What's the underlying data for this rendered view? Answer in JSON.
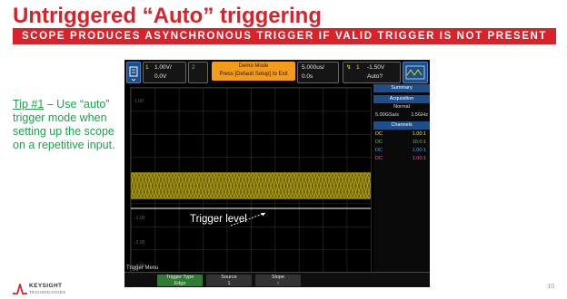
{
  "slide": {
    "title": "Untriggered “Auto” triggering",
    "banner": "SCOPE PRODUCES ASYNCHRONOUS TRIGGER IF VALID TRIGGER IS NOT PRESENT",
    "tip_label": "Tip #1",
    "tip_text": " – Use “auto” trigger mode when setting up the scope on a repetitive input.",
    "page_number": "10",
    "logo": "KEYSIGHT",
    "logo_sub": "TECHNOLOGIES"
  },
  "scope": {
    "vert_scale": "1.00V/",
    "vert_offset": "0.0V",
    "demo_line1": "Demo Mode",
    "demo_line2": "Press [Default Setup] to Exit",
    "time_scale": "5.000us/",
    "time_delay": "0.0s",
    "trig_channel": "1",
    "trig_level": "-1.50V",
    "trig_mode": "Auto?",
    "annotation": "Trigger level",
    "grid_labels": [
      "1.00",
      "-1.00",
      "-2.00",
      "-3.00"
    ],
    "side": {
      "summary": "Summary",
      "acq_title": "Acquisition",
      "acq_mode": "Normal",
      "acq_rate": "5.00GSa/s",
      "acq_bw": "1.5GHz",
      "channels_title": "Channels",
      "channels": [
        {
          "coupling": "DC",
          "value": "1.00:1",
          "color": "#f2e600"
        },
        {
          "coupling": "DC",
          "value": "10.0:1",
          "color": "#3ddc4a"
        },
        {
          "coupling": "DC",
          "value": "1.00:1",
          "color": "#4aa3ff"
        },
        {
          "coupling": "DC",
          "value": "1.00:1",
          "color": "#ff4fb0"
        }
      ]
    },
    "menu_title": "Trigger Menu",
    "softkeys": [
      {
        "line1": "Trigger Type",
        "line2": "Edge"
      },
      {
        "line1": "Source",
        "line2": "1"
      },
      {
        "line1": "Slope",
        "line2": "↑"
      }
    ]
  },
  "colors": {
    "brand_red": "#d8232a",
    "tip_green": "#1aa54a",
    "trace_yellow": "#c9b516",
    "demo_orange": "#f39c1a"
  }
}
